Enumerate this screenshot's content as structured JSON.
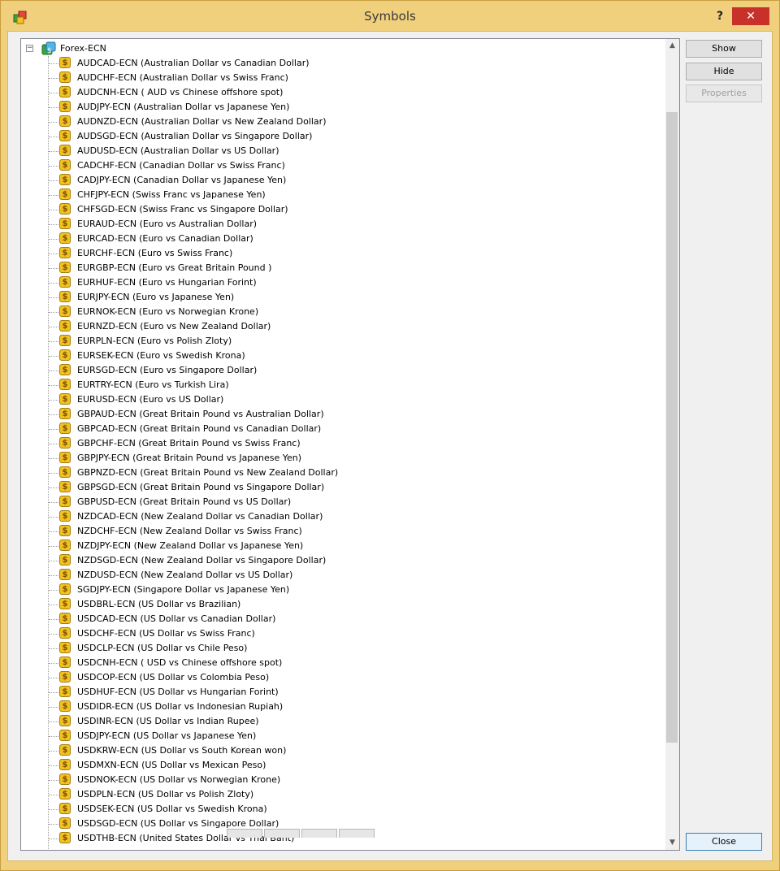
{
  "window": {
    "title": "Symbols",
    "help_label": "?",
    "close_glyph": "✕"
  },
  "colors": {
    "titlebar": "#f0cf7d",
    "close_button": "#c7312a",
    "coin_icon": "#f2c122"
  },
  "tree": {
    "root_label": "Forex-ECN",
    "expander": "−",
    "item_icon": "dollar-coin-icon",
    "items": [
      {
        "label": "AUDCAD-ECN  (Australian Dollar vs Canadian Dollar)"
      },
      {
        "label": "AUDCHF-ECN  (Australian Dollar vs Swiss Franc)"
      },
      {
        "label": "AUDCNH-ECN  ( AUD vs Chinese offshore spot)"
      },
      {
        "label": "AUDJPY-ECN  (Australian Dollar vs Japanese Yen)"
      },
      {
        "label": "AUDNZD-ECN  (Australian Dollar vs New Zealand Dollar)"
      },
      {
        "label": "AUDSGD-ECN  (Australian Dollar vs Singapore Dollar)"
      },
      {
        "label": "AUDUSD-ECN  (Australian Dollar vs US Dollar)"
      },
      {
        "label": "CADCHF-ECN  (Canadian Dollar vs Swiss Franc)"
      },
      {
        "label": "CADJPY-ECN  (Canadian Dollar vs Japanese Yen)"
      },
      {
        "label": "CHFJPY-ECN  (Swiss Franc vs Japanese Yen)"
      },
      {
        "label": "CHFSGD-ECN  (Swiss Franc vs Singapore Dollar)"
      },
      {
        "label": "EURAUD-ECN  (Euro vs Australian Dollar)"
      },
      {
        "label": "EURCAD-ECN  (Euro vs Canadian Dollar)"
      },
      {
        "label": "EURCHF-ECN  (Euro vs Swiss Franc)"
      },
      {
        "label": "EURGBP-ECN  (Euro vs Great Britain Pound )"
      },
      {
        "label": "EURHUF-ECN  (Euro vs Hungarian Forint)"
      },
      {
        "label": "EURJPY-ECN  (Euro vs Japanese Yen)"
      },
      {
        "label": "EURNOK-ECN  (Euro vs Norwegian Krone)"
      },
      {
        "label": "EURNZD-ECN  (Euro vs New Zealand Dollar)"
      },
      {
        "label": "EURPLN-ECN  (Euro vs Polish Zloty)"
      },
      {
        "label": "EURSEK-ECN  (Euro vs Swedish Krona)"
      },
      {
        "label": "EURSGD-ECN  (Euro vs Singapore Dollar)"
      },
      {
        "label": "EURTRY-ECN  (Euro vs Turkish Lira)"
      },
      {
        "label": "EURUSD-ECN  (Euro vs US Dollar)"
      },
      {
        "label": "GBPAUD-ECN  (Great Britain Pound vs Australian Dollar)"
      },
      {
        "label": "GBPCAD-ECN  (Great Britain Pound vs Canadian Dollar)"
      },
      {
        "label": "GBPCHF-ECN  (Great Britain Pound vs Swiss Franc)"
      },
      {
        "label": "GBPJPY-ECN  (Great Britain Pound vs Japanese Yen)"
      },
      {
        "label": "GBPNZD-ECN  (Great Britain Pound vs New Zealand Dollar)"
      },
      {
        "label": "GBPSGD-ECN  (Great Britain Pound vs Singapore Dollar)"
      },
      {
        "label": "GBPUSD-ECN  (Great Britain Pound vs US Dollar)"
      },
      {
        "label": "NZDCAD-ECN  (New Zealand Dollar vs Canadian Dollar)"
      },
      {
        "label": "NZDCHF-ECN  (New Zealand Dollar vs Swiss Franc)"
      },
      {
        "label": "NZDJPY-ECN  (New Zealand Dollar vs Japanese Yen)"
      },
      {
        "label": "NZDSGD-ECN  (New Zealand Dollar vs Singapore Dollar)"
      },
      {
        "label": "NZDUSD-ECN  (New Zealand Dollar vs US Dollar)"
      },
      {
        "label": "SGDJPY-ECN  (Singapore Dollar vs Japanese Yen)"
      },
      {
        "label": "USDBRL-ECN  (US Dollar vs Brazilian)"
      },
      {
        "label": "USDCAD-ECN  (US Dollar vs Canadian Dollar)"
      },
      {
        "label": "USDCHF-ECN  (US Dollar vs Swiss Franc)"
      },
      {
        "label": "USDCLP-ECN  (US Dollar vs Chile Peso)"
      },
      {
        "label": "USDCNH-ECN  ( USD vs Chinese offshore spot)"
      },
      {
        "label": "USDCOP-ECN  (US Dollar vs Colombia Peso)"
      },
      {
        "label": "USDHUF-ECN  (US Dollar vs Hungarian Forint)"
      },
      {
        "label": "USDIDR-ECN  (US Dollar vs Indonesian Rupiah)"
      },
      {
        "label": "USDINR-ECN  (US Dollar vs Indian Rupee)"
      },
      {
        "label": "USDJPY-ECN  (US Dollar vs Japanese Yen)"
      },
      {
        "label": "USDKRW-ECN  (US Dollar vs South Korean won)"
      },
      {
        "label": "USDMXN-ECN  (US Dollar vs Mexican Peso)"
      },
      {
        "label": "USDNOK-ECN  (US Dollar vs Norwegian Krone)"
      },
      {
        "label": "USDPLN-ECN  (US Dollar vs Polish Zloty)"
      },
      {
        "label": "USDSEK-ECN  (US Dollar vs Swedish Krona)"
      },
      {
        "label": "USDSGD-ECN  (US Dollar vs Singapore Dollar)"
      },
      {
        "label": "USDTHB-ECN  (United States Dollar vs Thai Baht)"
      }
    ]
  },
  "scrollbar": {
    "up_arrow": "▲",
    "down_arrow": "▼"
  },
  "buttons": {
    "show": "Show",
    "hide": "Hide",
    "properties": "Properties",
    "close": "Close"
  }
}
